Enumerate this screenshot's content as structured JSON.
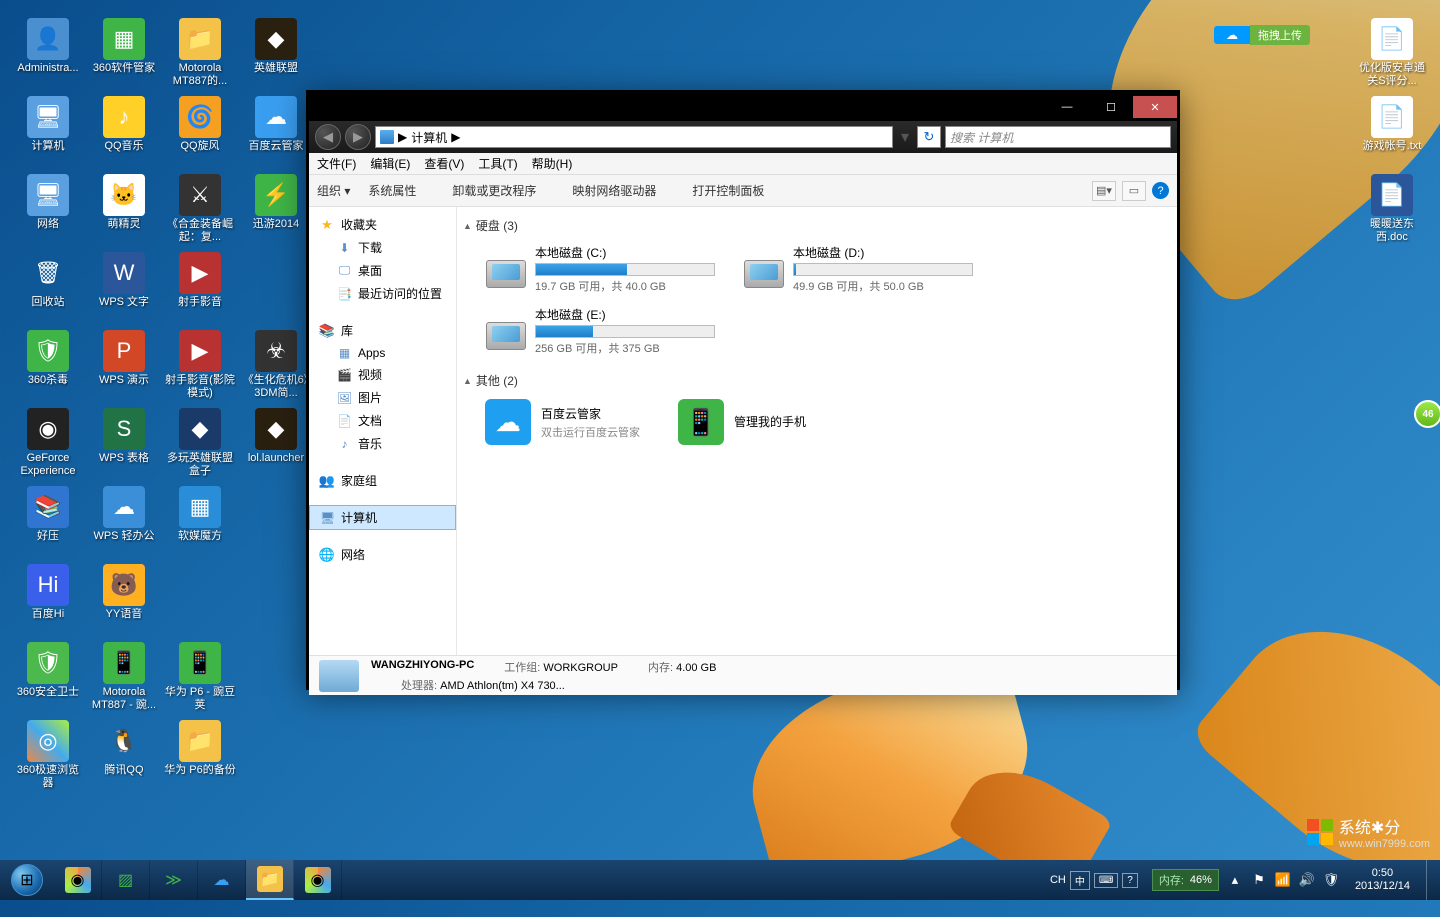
{
  "desktop": {
    "columns": [
      [
        {
          "label": "Administra...",
          "ico": "👤",
          "bg": "#4a90d0"
        },
        {
          "label": "计算机",
          "ico": "🖥",
          "bg": "#5aa0e0"
        },
        {
          "label": "网络",
          "ico": "🖥",
          "bg": "#5aa0e0"
        },
        {
          "label": "回收站",
          "ico": "🗑",
          "bg": "transparent"
        },
        {
          "label": "360杀毒",
          "ico": "🛡",
          "bg": "#3fb548"
        },
        {
          "label": "GeForce Experience",
          "ico": "◉",
          "bg": "#222"
        },
        {
          "label": "好压",
          "ico": "📚",
          "bg": "#3075d0"
        },
        {
          "label": "百度Hi",
          "ico": "Hi",
          "bg": "#3a5fea"
        },
        {
          "label": "360安全卫士",
          "ico": "🛡",
          "bg": "#4cb94c"
        },
        {
          "label": "360极速浏览器",
          "ico": "◎",
          "bg": "linear-gradient(45deg,#e84,#4ae,#ae4)"
        }
      ],
      [
        {
          "label": "360软件管家",
          "ico": "▦",
          "bg": "#3fb548"
        },
        {
          "label": "QQ音乐",
          "ico": "♪",
          "bg": "#ffd028"
        },
        {
          "label": "萌精灵",
          "ico": "🐱",
          "bg": "#fff"
        },
        {
          "label": "WPS 文字",
          "ico": "W",
          "bg": "#2b579a"
        },
        {
          "label": "WPS 演示",
          "ico": "P",
          "bg": "#d24726"
        },
        {
          "label": "WPS 表格",
          "ico": "S",
          "bg": "#217346"
        },
        {
          "label": "WPS 轻办公",
          "ico": "☁",
          "bg": "#3a8fd8"
        },
        {
          "label": "YY语音",
          "ico": "🐻",
          "bg": "#ffb020"
        },
        {
          "label": "Motorola MT887 - 豌...",
          "ico": "📱",
          "bg": "#3fb548"
        },
        {
          "label": "腾讯QQ",
          "ico": "🐧",
          "bg": "transparent"
        }
      ],
      [
        {
          "label": "Motorola MT887的...",
          "ico": "📁",
          "bg": "#f5c249"
        },
        {
          "label": "QQ旋风",
          "ico": "🌀",
          "bg": "#f5a020"
        },
        {
          "label": "《合金装备崛起：复...",
          "ico": "⚔",
          "bg": "#333"
        },
        {
          "label": "射手影音",
          "ico": "▶",
          "bg": "#b83232"
        },
        {
          "label": "射手影音(影院模式)",
          "ico": "▶",
          "bg": "#b83232"
        },
        {
          "label": "多玩英雄联盟盒子",
          "ico": "◆",
          "bg": "#1a3a6a"
        },
        {
          "label": "软媒魔方",
          "ico": "▦",
          "bg": "#2a8dd8"
        },
        {
          "label": "",
          "ico": "",
          "bg": "transparent"
        },
        {
          "label": "华为 P6 - 豌豆荚",
          "ico": "📱",
          "bg": "#3fb548"
        },
        {
          "label": "华为 P6的备份",
          "ico": "📁",
          "bg": "#f5c249"
        }
      ],
      [
        {
          "label": "英雄联盟",
          "ico": "◆",
          "bg": "#2a2010"
        },
        {
          "label": "百度云管家",
          "ico": "☁",
          "bg": "#3a9ef0"
        },
        {
          "label": "迅游2014",
          "ico": "⚡",
          "bg": "#3fb548"
        },
        {
          "label": "",
          "ico": "",
          "bg": ""
        },
        {
          "label": "《生化危机6》3DM简...",
          "ico": "☣",
          "bg": "#333"
        },
        {
          "label": "lol.launcher",
          "ico": "◆",
          "bg": "#2a2010"
        }
      ]
    ],
    "right_icons": [
      {
        "label": "优化版安卓通关S评分...",
        "ico": "📄",
        "bg": "#fff"
      },
      {
        "label": "游戏帐号.txt",
        "ico": "📄",
        "bg": "#fff"
      },
      {
        "label": "暖暖送东西.doc",
        "ico": "📄",
        "bg": "#2b579a"
      }
    ],
    "drag_widget": "拖拽上传"
  },
  "explorer": {
    "titlebar": {
      "min": "—",
      "max": "☐",
      "close": "✕"
    },
    "nav": {
      "back": "◀",
      "forward": "▶"
    },
    "address": {
      "location": "计算机",
      "sep": "▶"
    },
    "search_placeholder": "搜索 计算机",
    "menu": [
      "文件(F)",
      "编辑(E)",
      "查看(V)",
      "工具(T)",
      "帮助(H)"
    ],
    "toolbar": {
      "organize": "组织 ▾",
      "items": [
        "系统属性",
        "卸载或更改程序",
        "映射网络驱动器",
        "打开控制面板"
      ]
    },
    "sidebar": {
      "favorites": {
        "label": "收藏夹",
        "items": [
          {
            "label": "下载",
            "ico": "⬇"
          },
          {
            "label": "桌面",
            "ico": "🖵"
          },
          {
            "label": "最近访问的位置",
            "ico": "📑"
          }
        ]
      },
      "libraries": {
        "label": "库",
        "items": [
          {
            "label": "Apps",
            "ico": "▦"
          },
          {
            "label": "视频",
            "ico": "🎬"
          },
          {
            "label": "图片",
            "ico": "🖼"
          },
          {
            "label": "文档",
            "ico": "📄"
          },
          {
            "label": "音乐",
            "ico": "♪"
          }
        ]
      },
      "homegroup": {
        "label": "家庭组"
      },
      "computer": {
        "label": "计算机"
      },
      "network": {
        "label": "网络"
      }
    },
    "content": {
      "disks_header": "硬盘 (3)",
      "disks": [
        {
          "name": "本地磁盘 (C:)",
          "text": "19.7 GB 可用，共 40.0 GB",
          "pct": 51
        },
        {
          "name": "本地磁盘 (D:)",
          "text": "49.9 GB 可用，共 50.0 GB",
          "pct": 1
        },
        {
          "name": "本地磁盘 (E:)",
          "text": "256 GB 可用，共 375 GB",
          "pct": 32
        }
      ],
      "other_header": "其他 (2)",
      "others": [
        {
          "name": "百度云管家",
          "sub": "双击运行百度云管家",
          "bg": "#1e9ff0",
          "ico": "☁"
        },
        {
          "name": "管理我的手机",
          "sub": "",
          "bg": "#3fb548",
          "ico": "📱"
        }
      ]
    },
    "status": {
      "name": "WANGZHIYONG-PC",
      "workgroup_label": "工作组:",
      "workgroup": "WORKGROUP",
      "cpu_label": "处理器:",
      "cpu": "AMD Athlon(tm) X4 730...",
      "mem_label": "内存:",
      "mem": "4.00 GB"
    }
  },
  "taskbar": {
    "ime": {
      "lang": "CH",
      "mode": "中"
    },
    "memory": {
      "label": "内存:",
      "value": "46%"
    },
    "time": "0:50",
    "date": "2013/12/14"
  },
  "watermark": {
    "brand": "系统✱分",
    "url": "www.win7999.com"
  },
  "side_bubble": "46"
}
